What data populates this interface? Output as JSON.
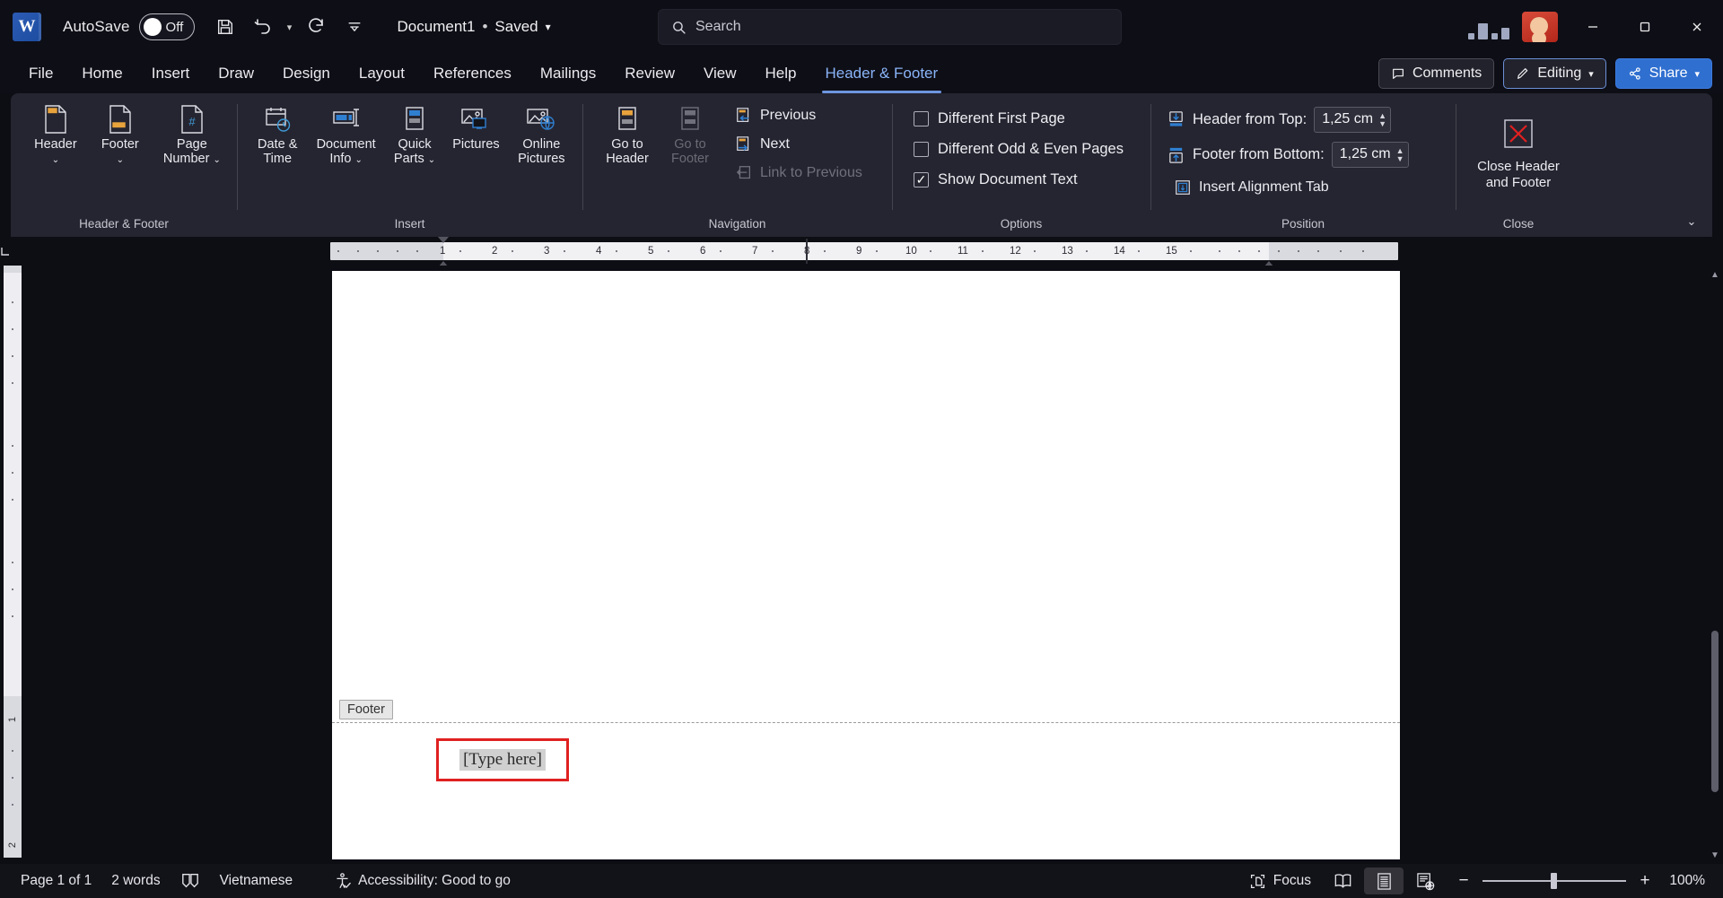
{
  "titlebar": {
    "logo_text": "W",
    "autosave_label": "AutoSave",
    "autosave_state": "Off",
    "save_icon": "save-icon",
    "undo_icon": "undo-icon",
    "redo_icon": "redo-icon",
    "customize_icon": "customize-quick-access-icon",
    "document_title": "Document1",
    "separator": "•",
    "saved_status": "Saved",
    "minimize": "—",
    "maximize": "▢",
    "close": "✕"
  },
  "search": {
    "placeholder": "Search",
    "icon": "search-icon"
  },
  "tabs": [
    {
      "label": "File",
      "active": false
    },
    {
      "label": "Home",
      "active": false
    },
    {
      "label": "Insert",
      "active": false
    },
    {
      "label": "Draw",
      "active": false
    },
    {
      "label": "Design",
      "active": false
    },
    {
      "label": "Layout",
      "active": false
    },
    {
      "label": "References",
      "active": false
    },
    {
      "label": "Mailings",
      "active": false
    },
    {
      "label": "Review",
      "active": false
    },
    {
      "label": "View",
      "active": false
    },
    {
      "label": "Help",
      "active": false
    },
    {
      "label": "Header & Footer",
      "active": true
    }
  ],
  "tab_accent_color": "#6e96e0",
  "topright": {
    "comments_label": "Comments",
    "editing_label": "Editing",
    "share_label": "Share"
  },
  "ribbon": {
    "groups": [
      {
        "title": "Header & Footer",
        "buttons": [
          {
            "label": "Header",
            "caret": true,
            "icon": "header-icon",
            "disabled": false
          },
          {
            "label": "Footer",
            "caret": true,
            "icon": "footer-icon",
            "disabled": false
          },
          {
            "label": "Page Number",
            "caret": true,
            "icon": "page-number-icon",
            "disabled": false
          }
        ]
      },
      {
        "title": "Insert",
        "buttons": [
          {
            "label": "Date & Time",
            "caret": false,
            "icon": "date-time-icon",
            "disabled": false
          },
          {
            "label": "Document Info",
            "caret": true,
            "icon": "document-info-icon",
            "disabled": false
          },
          {
            "label": "Quick Parts",
            "caret": true,
            "icon": "quick-parts-icon",
            "disabled": false
          },
          {
            "label": "Pictures",
            "caret": false,
            "icon": "pictures-icon",
            "disabled": false
          },
          {
            "label": "Online Pictures",
            "caret": false,
            "icon": "online-pictures-icon",
            "disabled": false
          }
        ]
      },
      {
        "title": "Navigation",
        "buttons": [
          {
            "label": "Go to Header",
            "caret": false,
            "icon": "go-to-header-icon",
            "disabled": false
          },
          {
            "label": "Go to Footer",
            "caret": false,
            "icon": "go-to-footer-icon",
            "disabled": true
          }
        ],
        "small_buttons": [
          {
            "label": "Previous",
            "icon": "previous-icon",
            "disabled": false
          },
          {
            "label": "Next",
            "icon": "next-icon",
            "disabled": false
          },
          {
            "label": "Link to Previous",
            "icon": "link-to-previous-icon",
            "disabled": true
          }
        ]
      },
      {
        "title": "Options",
        "checkboxes": [
          {
            "label": "Different First Page",
            "checked": false
          },
          {
            "label": "Different Odd & Even Pages",
            "checked": false
          },
          {
            "label": "Show Document Text",
            "checked": true
          }
        ]
      },
      {
        "title": "Position",
        "fields": [
          {
            "label": "Header from Top:",
            "value": "1,25 cm",
            "icon": "header-from-top-icon"
          },
          {
            "label": "Footer from Bottom:",
            "value": "1,25 cm",
            "icon": "footer-from-bottom-icon"
          }
        ],
        "action": {
          "label": "Insert Alignment Tab",
          "icon": "insert-alignment-tab-icon"
        }
      },
      {
        "title": "Close",
        "close_button": {
          "line1": "Close Header",
          "line2": "and Footer",
          "icon": "close-header-footer-icon"
        }
      }
    ],
    "collapse_icon": "chevron-down-icon"
  },
  "ruler": {
    "h_numbers": [
      "1",
      "2",
      "3",
      "4",
      "5",
      "6",
      "7",
      "8",
      "9",
      "10",
      "11",
      "12",
      "13",
      "14",
      "15"
    ],
    "v_numbers": [
      "1",
      "2"
    ]
  },
  "document": {
    "footer_tag_label": "Footer",
    "type_here_placeholder": "[Type here]",
    "highlight_color": "#e02020"
  },
  "statusbar": {
    "page_info": "Page 1 of 1",
    "word_count": "2 words",
    "proofing_icon": "proofing-icon",
    "language": "Vietnamese",
    "accessibility_icon": "accessibility-icon",
    "accessibility": "Accessibility: Good to go",
    "focus_label": "Focus",
    "focus_icon": "focus-icon",
    "read_mode_icon": "read-mode-icon",
    "print_layout_icon": "print-layout-icon",
    "web_layout_icon": "web-layout-icon",
    "zoom_out": "−",
    "zoom_in": "+",
    "zoom_level": "100%"
  }
}
